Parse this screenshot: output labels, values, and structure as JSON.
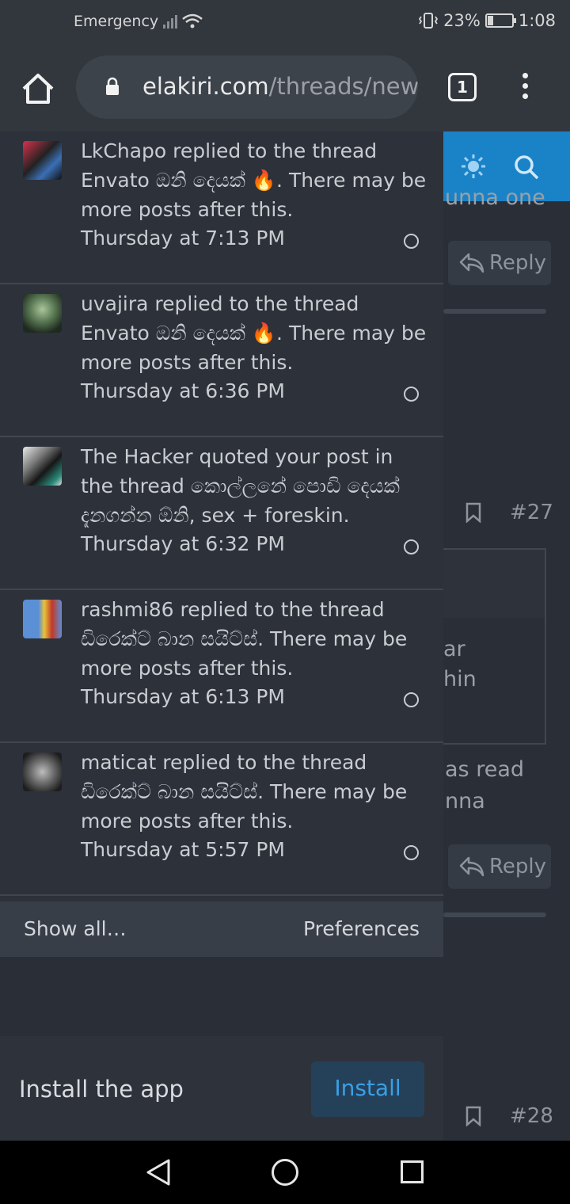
{
  "status_bar": {
    "carrier": "Emergency",
    "battery_percent": "23%",
    "battery_level": 0.23,
    "time": "1:08"
  },
  "browser": {
    "url_domain": "elakiri.com",
    "url_path": "/threads/new",
    "tab_count": "1",
    "icons": [
      "home-icon",
      "lock-icon",
      "tabs-icon",
      "overflow-menu-icon"
    ]
  },
  "notifications": [
    {
      "text": "LkChapo replied to the thread Envato ඔනි දෙයක් 🔥. There may be more posts after this.",
      "time": "Thursday at 7:13 PM"
    },
    {
      "text": "uvajira replied to the thread Envato ඔනි දෙයක් 🔥. There may be more posts after this.",
      "time": "Thursday at 6:36 PM"
    },
    {
      "text": "The Hacker quoted your post in the thread කොල්ලනේ පොඩි දෙයක් දැනගන්න ඕනි, sex + foreskin.",
      "time": "Thursday at 6:32 PM"
    },
    {
      "text": "rashmi86 replied to the thread ඩිරෙක්ට් බාන සයිට්ස්. There may be more posts after this.",
      "time": "Thursday at 6:13 PM"
    },
    {
      "text": "maticat replied to the thread ඩිරෙක්ට් බාන සයිට්ස්. There may be more posts after this.",
      "time": "Thursday at 5:57 PM"
    }
  ],
  "panel_footer": {
    "show_all": "Show all…",
    "preferences": "Preferences"
  },
  "background_page": {
    "fragment_top": "unna one",
    "reply_label": "Reply",
    "post_27": "#27",
    "fragment_ar": "ar",
    "fragment_hin": "hin",
    "fragment_as_read": "as read",
    "fragment_nna": "nna",
    "post_28": "#28"
  },
  "install_bar": {
    "label": "Install the app",
    "button": "Install"
  },
  "colors": {
    "panel_bg": "#2c313a",
    "header_blue": "#1a83c7",
    "install_text": "#3aa0e6"
  }
}
